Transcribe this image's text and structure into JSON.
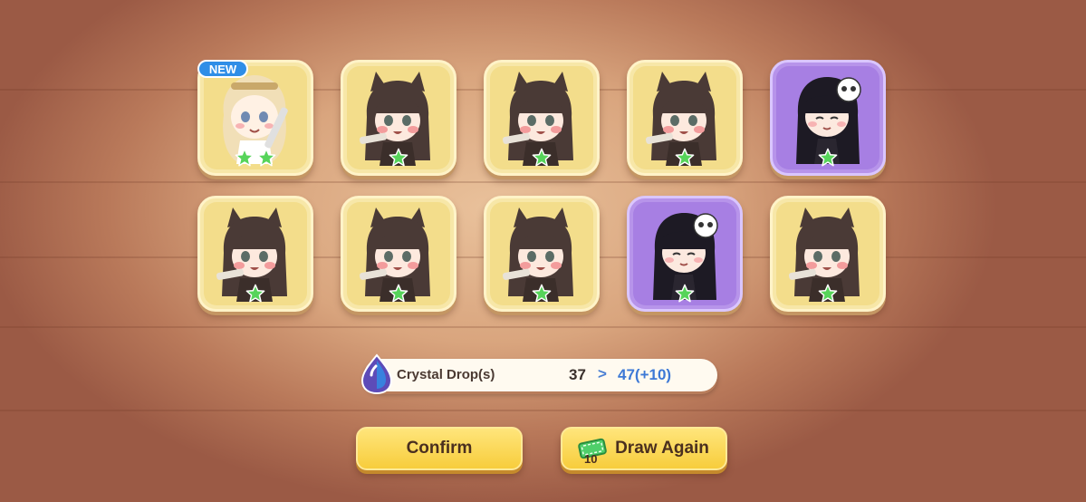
{
  "cards": [
    {
      "frame": "yellow",
      "character": "blonde-girl",
      "stars": 2,
      "is_new": true
    },
    {
      "frame": "yellow",
      "character": "wolf-ear-girl",
      "stars": 1,
      "is_new": false
    },
    {
      "frame": "yellow",
      "character": "wolf-ear-girl",
      "stars": 1,
      "is_new": false
    },
    {
      "frame": "yellow",
      "character": "wolf-ear-girl",
      "stars": 1,
      "is_new": false
    },
    {
      "frame": "purple",
      "character": "skull-hair-girl",
      "stars": 1,
      "is_new": false
    },
    {
      "frame": "yellow",
      "character": "wolf-ear-girl",
      "stars": 1,
      "is_new": false
    },
    {
      "frame": "yellow",
      "character": "wolf-ear-girl",
      "stars": 1,
      "is_new": false
    },
    {
      "frame": "yellow",
      "character": "wolf-ear-girl",
      "stars": 1,
      "is_new": false
    },
    {
      "frame": "purple",
      "character": "skull-hair-girl",
      "stars": 1,
      "is_new": false
    },
    {
      "frame": "yellow",
      "character": "wolf-ear-girl",
      "stars": 1,
      "is_new": false
    }
  ],
  "new_badge": "NEW",
  "crystal": {
    "icon": "crystal-drop-icon",
    "label": "Crystal Drop(s)",
    "old_value": "37",
    "arrow": ">",
    "new_value": "47(+10)"
  },
  "buttons": {
    "confirm": "Confirm",
    "draw_again": "Draw Again",
    "draw_ticket_count": "10"
  },
  "colors": {
    "yellow_frame": "#f7e7a8",
    "purple_frame": "#b794ea",
    "button": "#f7cd3c",
    "accent_blue": "#3d79d6"
  }
}
